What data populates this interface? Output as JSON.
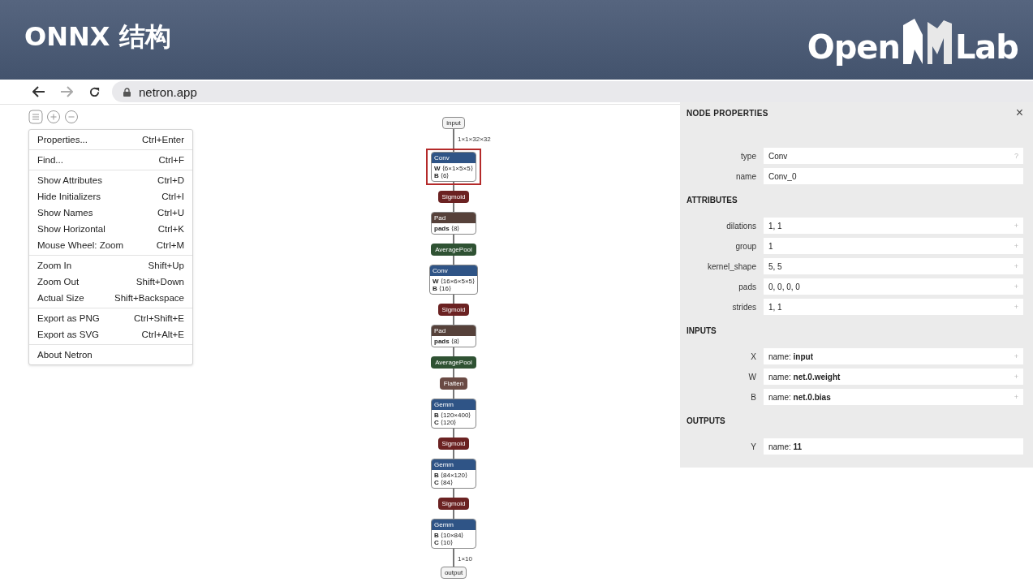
{
  "slide": {
    "title": "ONNX 结构",
    "logo": {
      "left": "Open",
      "right": "Lab"
    }
  },
  "browser": {
    "nav": [
      {
        "kind": "back",
        "disabled": false
      },
      {
        "kind": "forward",
        "disabled": true
      },
      {
        "kind": "reload",
        "disabled": false
      }
    ],
    "address": "netron.app"
  },
  "toolbar": [
    {
      "kind": "menu"
    },
    {
      "kind": "zoom-in"
    },
    {
      "kind": "zoom-out"
    }
  ],
  "menu": {
    "groups": [
      [
        {
          "label": "Properties...",
          "shortcut": "Ctrl+Enter"
        }
      ],
      [
        {
          "label": "Find...",
          "shortcut": "Ctrl+F"
        }
      ],
      [
        {
          "label": "Show Attributes",
          "shortcut": "Ctrl+D"
        },
        {
          "label": "Hide Initializers",
          "shortcut": "Ctrl+I"
        },
        {
          "label": "Show Names",
          "shortcut": "Ctrl+U"
        },
        {
          "label": "Show Horizontal",
          "shortcut": "Ctrl+K"
        },
        {
          "label": "Mouse Wheel: Zoom",
          "shortcut": "Ctrl+M"
        }
      ],
      [
        {
          "label": "Zoom In",
          "shortcut": "Shift+Up"
        },
        {
          "label": "Zoom Out",
          "shortcut": "Shift+Down"
        },
        {
          "label": "Actual Size",
          "shortcut": "Shift+Backspace"
        }
      ],
      [
        {
          "label": "Export as PNG",
          "shortcut": "Ctrl+Shift+E"
        },
        {
          "label": "Export as SVG",
          "shortcut": "Ctrl+Alt+E"
        }
      ],
      [
        {
          "label": "About Netron"
        }
      ]
    ]
  },
  "graph": {
    "nodes": [
      {
        "kind": "io",
        "label": "input",
        "selected": false,
        "edge_label": "1×1×32×32"
      },
      {
        "kind": "block",
        "label": "Conv",
        "color": "#2f5486",
        "selected": true,
        "attrs": [
          {
            "name": "W",
            "value": "⟨6×1×5×5⟩"
          },
          {
            "name": "B",
            "value": "⟨6⟩"
          }
        ]
      },
      {
        "kind": "op",
        "label": "Sigmoid",
        "color": "#6b2222",
        "selected": false
      },
      {
        "kind": "block",
        "label": "Pad",
        "color": "#56413a",
        "selected": false,
        "attrs": [
          {
            "name": "pads",
            "value": "⟨8⟩"
          }
        ]
      },
      {
        "kind": "op",
        "label": "AveragePool",
        "color": "#2f5233",
        "selected": false
      },
      {
        "kind": "block",
        "label": "Conv",
        "color": "#2f5486",
        "selected": false,
        "attrs": [
          {
            "name": "W",
            "value": "⟨16×6×5×5⟩"
          },
          {
            "name": "B",
            "value": "⟨16⟩"
          }
        ]
      },
      {
        "kind": "op",
        "label": "Sigmoid",
        "color": "#6b2222",
        "selected": false
      },
      {
        "kind": "block",
        "label": "Pad",
        "color": "#56413a",
        "selected": false,
        "attrs": [
          {
            "name": "pads",
            "value": "⟨8⟩"
          }
        ]
      },
      {
        "kind": "op",
        "label": "AveragePool",
        "color": "#2f5233",
        "selected": false
      },
      {
        "kind": "op",
        "label": "Flatten",
        "color": "#6a4a44",
        "selected": false
      },
      {
        "kind": "block",
        "label": "Gemm",
        "color": "#2f5486",
        "selected": false,
        "attrs": [
          {
            "name": "B",
            "value": "⟨120×400⟩"
          },
          {
            "name": "C",
            "value": "⟨120⟩"
          }
        ]
      },
      {
        "kind": "op",
        "label": "Sigmoid",
        "color": "#6b2222",
        "selected": false
      },
      {
        "kind": "block",
        "label": "Gemm",
        "color": "#2f5486",
        "selected": false,
        "attrs": [
          {
            "name": "B",
            "value": "⟨84×120⟩"
          },
          {
            "name": "C",
            "value": "⟨84⟩"
          }
        ]
      },
      {
        "kind": "op",
        "label": "Sigmoid",
        "color": "#6b2222",
        "selected": false
      },
      {
        "kind": "block",
        "label": "Gemm",
        "color": "#2f5486",
        "selected": false,
        "attrs": [
          {
            "name": "B",
            "value": "⟨10×84⟩"
          },
          {
            "name": "C",
            "value": "⟨10⟩"
          }
        ],
        "edge_label": "1×10"
      },
      {
        "kind": "io",
        "label": "output",
        "selected": false
      }
    ]
  },
  "properties": {
    "title": "NODE PROPERTIES",
    "close": "×",
    "sections": [
      {
        "rows": [
          {
            "label": "type",
            "value": "Conv",
            "action": "?"
          },
          {
            "label": "name",
            "value": "Conv_0"
          }
        ]
      },
      {
        "title": "ATTRIBUTES",
        "rows": [
          {
            "label": "dilations",
            "value": "1, 1",
            "action": "+"
          },
          {
            "label": "group",
            "value": "1",
            "action": "+"
          },
          {
            "label": "kernel_shape",
            "value": "5, 5",
            "action": "+"
          },
          {
            "label": "pads",
            "value": "0, 0, 0, 0",
            "action": "+"
          },
          {
            "label": "strides",
            "value": "1, 1",
            "action": "+"
          }
        ]
      },
      {
        "title": "INPUTS",
        "rows": [
          {
            "label": "X",
            "value": "name: **input**",
            "action": "+"
          },
          {
            "label": "W",
            "value": "name: **net.0.weight**",
            "action": "+"
          },
          {
            "label": "B",
            "value": "name: **net.0.bias**",
            "action": "+"
          }
        ]
      },
      {
        "title": "OUTPUTS",
        "rows": [
          {
            "label": "Y",
            "value": "name: **11**"
          }
        ]
      }
    ]
  }
}
